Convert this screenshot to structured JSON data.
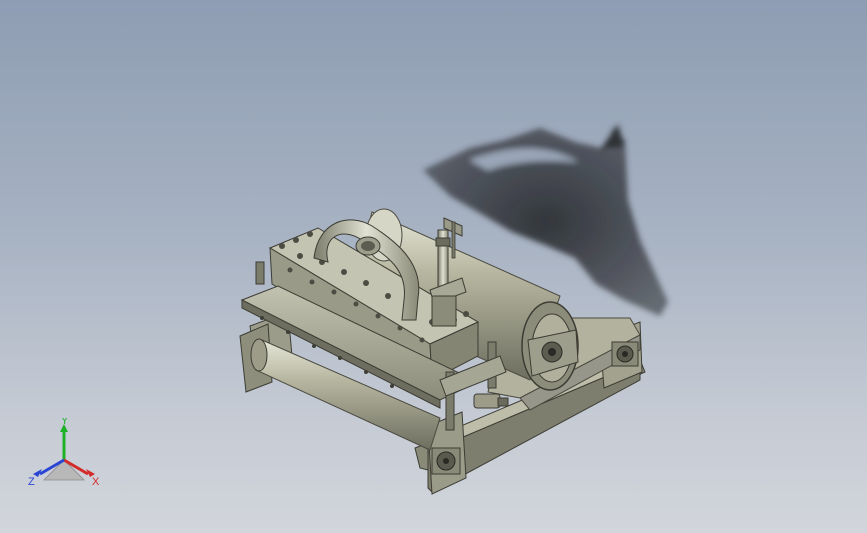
{
  "viewport": {
    "background_top": "#8e9db3",
    "background_bottom": "#d2d5db"
  },
  "model": {
    "part_color": "#a9a993",
    "shadow_color": "#2e3035"
  },
  "triad": {
    "x_label": "X",
    "y_label": "Y",
    "z_label": "Z",
    "x_color": "#d42a2a",
    "y_color": "#1fb02a",
    "z_color": "#2a45d4"
  }
}
